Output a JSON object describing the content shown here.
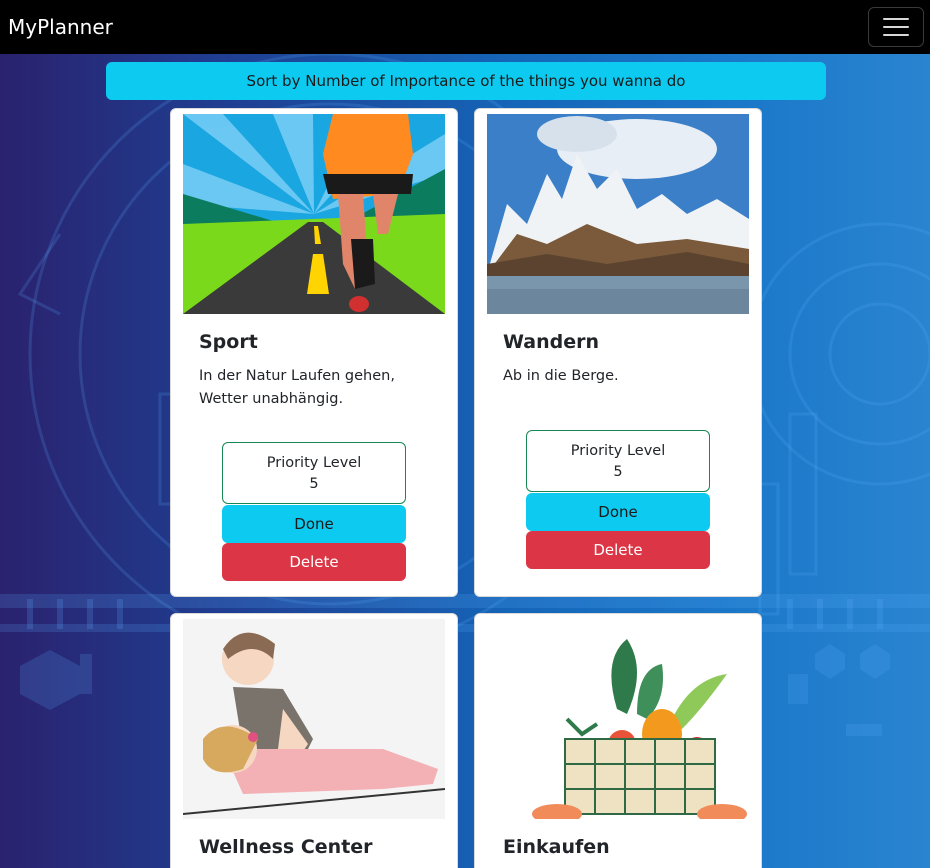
{
  "navbar": {
    "brand": "MyPlanner",
    "menu_icon": "hamburger-icon"
  },
  "sort_button": {
    "label": "Sort by Number of Importance of the things you wanna do"
  },
  "cards": [
    {
      "title": "Sport",
      "description": "In der Natur Laufen gehen, Wetter unabhängig.",
      "priority_label": "Priority Level",
      "priority_value": "5",
      "done_label": "Done",
      "delete_label": "Delete",
      "image": "runner-on-road-illustration"
    },
    {
      "title": "Wandern",
      "description": "Ab in die Berge.",
      "priority_label": "Priority Level",
      "priority_value": "5",
      "done_label": "Done",
      "delete_label": "Delete",
      "image": "snowy-mountains-lake-photo"
    },
    {
      "title": "Wellness Center",
      "image": "massage-illustration"
    },
    {
      "title": "Einkaufen",
      "image": "vegetable-grocery-bag-illustration"
    }
  ],
  "colors": {
    "info": "#0dcaf0",
    "danger": "#dc3545",
    "success": "#198754",
    "navbar": "#000000"
  }
}
